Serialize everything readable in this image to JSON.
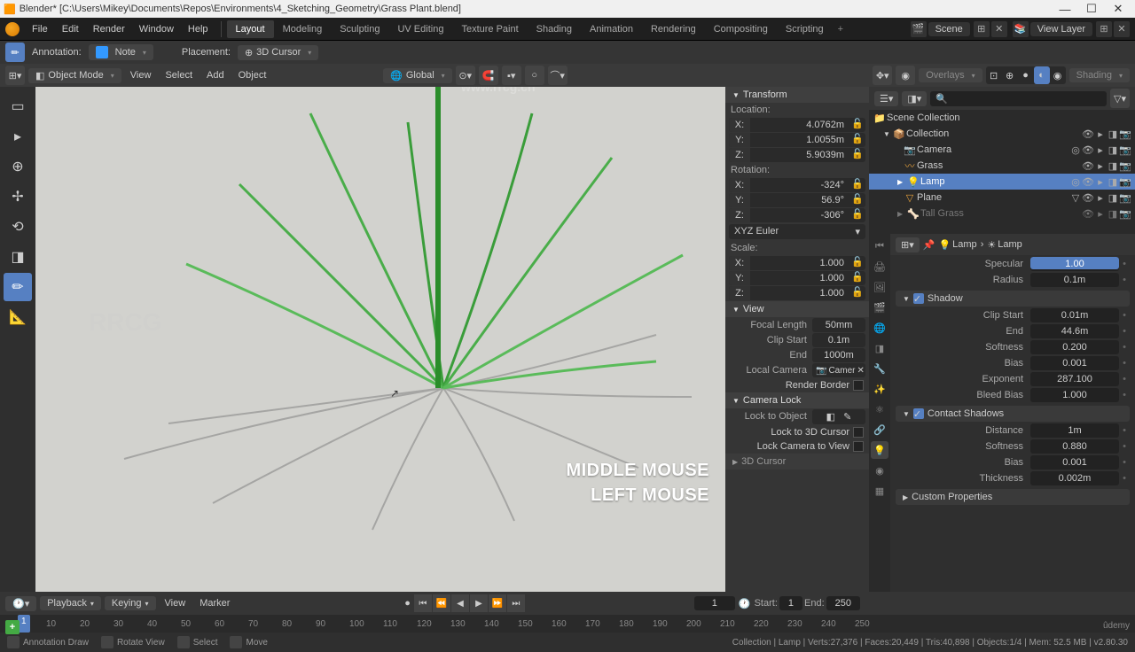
{
  "title_bar": {
    "icon": "blender",
    "title": "Blender* [C:\\Users\\Mikey\\Documents\\Repos\\Environments\\4_Sketching_Geometry\\Grass Plant.blend]"
  },
  "top_menu": {
    "items": [
      "File",
      "Edit",
      "Render",
      "Window",
      "Help"
    ],
    "workspaces": [
      "Layout",
      "Modeling",
      "Sculpting",
      "UV Editing",
      "Texture Paint",
      "Shading",
      "Animation",
      "Rendering",
      "Compositing",
      "Scripting"
    ],
    "active_workspace": "Layout",
    "scene": "Scene",
    "view_layer": "View Layer"
  },
  "tool_settings": {
    "annotation_label": "Annotation:",
    "color": "#3399ff",
    "layer": "Note",
    "placement_label": "Placement:",
    "placement": "3D Cursor"
  },
  "header": {
    "mode": "Object Mode",
    "menus": [
      "View",
      "Select",
      "Add",
      "Object"
    ],
    "orientation": "Global",
    "overlays": "Overlays",
    "shading": "Shading"
  },
  "toolbar": {
    "tools": [
      "select-box",
      "cursor",
      "move",
      "rotate",
      "scale",
      "transform",
      "annotate",
      "measure"
    ],
    "active": "annotate"
  },
  "viewport": {
    "overlay1": "MIDDLE MOUSE",
    "overlay2": "LEFT MOUSE"
  },
  "n_panel": {
    "transform": "Transform",
    "location": "Location:",
    "loc": {
      "x": "4.0762m",
      "y": "1.0055m",
      "z": "5.9039m"
    },
    "rotation": "Rotation:",
    "rot": {
      "x": "-324°",
      "y": "56.9°",
      "z": "-306°"
    },
    "rot_mode": "XYZ Euler",
    "scale": "Scale:",
    "scl": {
      "x": "1.000",
      "y": "1.000",
      "z": "1.000"
    },
    "view_h": "View",
    "focal_label": "Focal Length",
    "focal": "50mm",
    "clip_start_label": "Clip Start",
    "clip_start": "0.1m",
    "end_label": "End",
    "end": "1000m",
    "local_camera": "Local Camera",
    "camera_val": "Camer",
    "render_border": "Render Border",
    "camera_lock": "Camera Lock",
    "lock_to_object": "Lock to Object",
    "lock_to_cursor": "Lock to 3D Cursor",
    "lock_camera_view": "Lock Camera to View",
    "cursor_h": "3D Cursor"
  },
  "outliner": {
    "scene_collection": "Scene Collection",
    "collection": "Collection",
    "items": [
      {
        "name": "Camera",
        "icon": "📷",
        "sel": false,
        "extra": "●"
      },
      {
        "name": "Grass",
        "icon": "〰",
        "sel": false
      },
      {
        "name": "Lamp",
        "icon": "💡",
        "sel": true,
        "extra": "●"
      },
      {
        "name": "Plane",
        "icon": "▽",
        "sel": false,
        "extra": "▽"
      },
      {
        "name": "Tall Grass",
        "icon": "🦴",
        "sel": false,
        "grey": true
      }
    ]
  },
  "props": {
    "crumb1": "Lamp",
    "crumb2": "Lamp",
    "specular_label": "Specular",
    "specular": "1.00",
    "radius_label": "Radius",
    "radius": "0.1m",
    "shadow": "Shadow",
    "clip_start_label": "Clip Start",
    "clip_start": "0.01m",
    "end_label": "End",
    "end": "44.6m",
    "softness_label": "Softness",
    "softness": "0.200",
    "bias_label": "Bias",
    "bias": "0.001",
    "exponent_label": "Exponent",
    "exponent": "287.100",
    "bleed_bias_label": "Bleed Bias",
    "bleed_bias": "1.000",
    "contact_shadows": "Contact Shadows",
    "distance_label": "Distance",
    "distance": "1m",
    "cs_softness_label": "Softness",
    "cs_softness": "0.880",
    "cs_bias_label": "Bias",
    "cs_bias": "0.001",
    "thickness_label": "Thickness",
    "thickness": "0.002m",
    "custom_props": "Custom Properties"
  },
  "timeline": {
    "playback": "Playback",
    "keying": "Keying",
    "menus": [
      "View",
      "Marker"
    ],
    "cur_frame": "1",
    "start_label": "Start:",
    "start": "1",
    "end_label": "End:",
    "end": "250",
    "ticks": [
      "1",
      "10",
      "20",
      "30",
      "40",
      "50",
      "60",
      "70",
      "80",
      "90",
      "100",
      "110",
      "120",
      "130",
      "140",
      "150",
      "160",
      "170",
      "180",
      "190",
      "200",
      "210",
      "220",
      "230",
      "240",
      "250"
    ]
  },
  "status": {
    "items": [
      "Annotation Draw",
      "Rotate View",
      "Select",
      "Move"
    ],
    "info": "Collection | Lamp | Verts:27,376 | Faces:20,449 | Tris:40,898 | Objects:1/4 | Mem: 52.5 MB | v2.80.30"
  },
  "watermark_top": "www.rrcg.cn",
  "watermark_big": "RRCG"
}
